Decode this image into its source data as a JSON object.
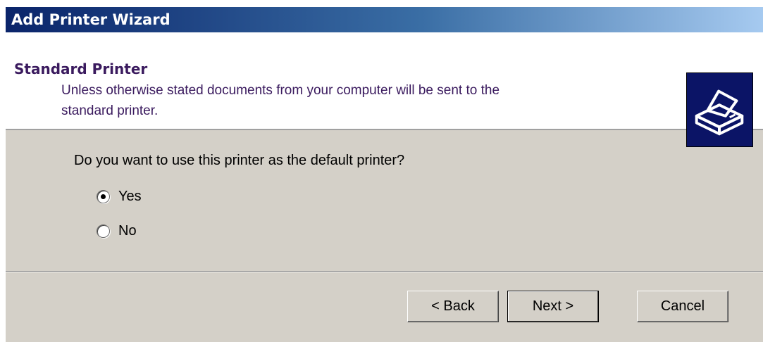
{
  "window": {
    "title": "Add Printer Wizard"
  },
  "header": {
    "title": "Standard Printer",
    "subtitle": "Unless otherwise stated documents from your computer will be sent to the standard printer.",
    "icon": "printer-icon"
  },
  "main": {
    "question": "Do you want to use this printer as the default printer?",
    "options": [
      {
        "label": "Yes",
        "selected": true
      },
      {
        "label": "No",
        "selected": false
      }
    ]
  },
  "buttons": {
    "back": "< Back",
    "next": "Next >",
    "cancel": "Cancel"
  },
  "colors": {
    "title_gradient_start": "#0a246a",
    "title_gradient_end": "#a6caf0",
    "dialog_background": "#d4d0c8",
    "header_text": "#3a1a5e",
    "icon_background": "#0b1466"
  }
}
